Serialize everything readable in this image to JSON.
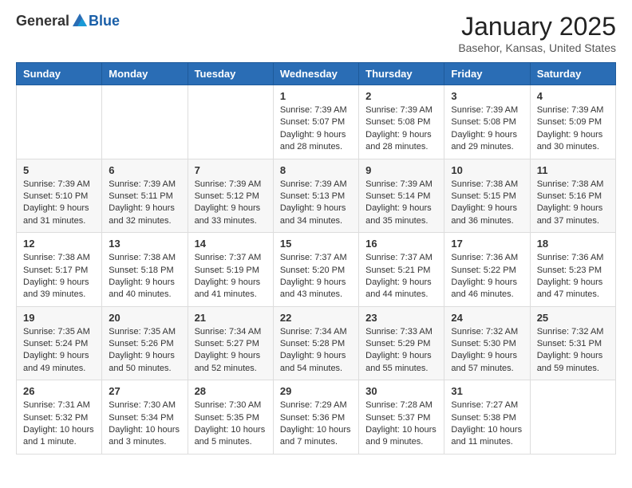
{
  "header": {
    "logo_general": "General",
    "logo_blue": "Blue",
    "title": "January 2025",
    "subtitle": "Basehor, Kansas, United States"
  },
  "weekdays": [
    "Sunday",
    "Monday",
    "Tuesday",
    "Wednesday",
    "Thursday",
    "Friday",
    "Saturday"
  ],
  "weeks": [
    [
      {
        "day": "",
        "info": ""
      },
      {
        "day": "",
        "info": ""
      },
      {
        "day": "",
        "info": ""
      },
      {
        "day": "1",
        "info": "Sunrise: 7:39 AM\nSunset: 5:07 PM\nDaylight: 9 hours\nand 28 minutes."
      },
      {
        "day": "2",
        "info": "Sunrise: 7:39 AM\nSunset: 5:08 PM\nDaylight: 9 hours\nand 28 minutes."
      },
      {
        "day": "3",
        "info": "Sunrise: 7:39 AM\nSunset: 5:08 PM\nDaylight: 9 hours\nand 29 minutes."
      },
      {
        "day": "4",
        "info": "Sunrise: 7:39 AM\nSunset: 5:09 PM\nDaylight: 9 hours\nand 30 minutes."
      }
    ],
    [
      {
        "day": "5",
        "info": "Sunrise: 7:39 AM\nSunset: 5:10 PM\nDaylight: 9 hours\nand 31 minutes."
      },
      {
        "day": "6",
        "info": "Sunrise: 7:39 AM\nSunset: 5:11 PM\nDaylight: 9 hours\nand 32 minutes."
      },
      {
        "day": "7",
        "info": "Sunrise: 7:39 AM\nSunset: 5:12 PM\nDaylight: 9 hours\nand 33 minutes."
      },
      {
        "day": "8",
        "info": "Sunrise: 7:39 AM\nSunset: 5:13 PM\nDaylight: 9 hours\nand 34 minutes."
      },
      {
        "day": "9",
        "info": "Sunrise: 7:39 AM\nSunset: 5:14 PM\nDaylight: 9 hours\nand 35 minutes."
      },
      {
        "day": "10",
        "info": "Sunrise: 7:38 AM\nSunset: 5:15 PM\nDaylight: 9 hours\nand 36 minutes."
      },
      {
        "day": "11",
        "info": "Sunrise: 7:38 AM\nSunset: 5:16 PM\nDaylight: 9 hours\nand 37 minutes."
      }
    ],
    [
      {
        "day": "12",
        "info": "Sunrise: 7:38 AM\nSunset: 5:17 PM\nDaylight: 9 hours\nand 39 minutes."
      },
      {
        "day": "13",
        "info": "Sunrise: 7:38 AM\nSunset: 5:18 PM\nDaylight: 9 hours\nand 40 minutes."
      },
      {
        "day": "14",
        "info": "Sunrise: 7:37 AM\nSunset: 5:19 PM\nDaylight: 9 hours\nand 41 minutes."
      },
      {
        "day": "15",
        "info": "Sunrise: 7:37 AM\nSunset: 5:20 PM\nDaylight: 9 hours\nand 43 minutes."
      },
      {
        "day": "16",
        "info": "Sunrise: 7:37 AM\nSunset: 5:21 PM\nDaylight: 9 hours\nand 44 minutes."
      },
      {
        "day": "17",
        "info": "Sunrise: 7:36 AM\nSunset: 5:22 PM\nDaylight: 9 hours\nand 46 minutes."
      },
      {
        "day": "18",
        "info": "Sunrise: 7:36 AM\nSunset: 5:23 PM\nDaylight: 9 hours\nand 47 minutes."
      }
    ],
    [
      {
        "day": "19",
        "info": "Sunrise: 7:35 AM\nSunset: 5:24 PM\nDaylight: 9 hours\nand 49 minutes."
      },
      {
        "day": "20",
        "info": "Sunrise: 7:35 AM\nSunset: 5:26 PM\nDaylight: 9 hours\nand 50 minutes."
      },
      {
        "day": "21",
        "info": "Sunrise: 7:34 AM\nSunset: 5:27 PM\nDaylight: 9 hours\nand 52 minutes."
      },
      {
        "day": "22",
        "info": "Sunrise: 7:34 AM\nSunset: 5:28 PM\nDaylight: 9 hours\nand 54 minutes."
      },
      {
        "day": "23",
        "info": "Sunrise: 7:33 AM\nSunset: 5:29 PM\nDaylight: 9 hours\nand 55 minutes."
      },
      {
        "day": "24",
        "info": "Sunrise: 7:32 AM\nSunset: 5:30 PM\nDaylight: 9 hours\nand 57 minutes."
      },
      {
        "day": "25",
        "info": "Sunrise: 7:32 AM\nSunset: 5:31 PM\nDaylight: 9 hours\nand 59 minutes."
      }
    ],
    [
      {
        "day": "26",
        "info": "Sunrise: 7:31 AM\nSunset: 5:32 PM\nDaylight: 10 hours\nand 1 minute."
      },
      {
        "day": "27",
        "info": "Sunrise: 7:30 AM\nSunset: 5:34 PM\nDaylight: 10 hours\nand 3 minutes."
      },
      {
        "day": "28",
        "info": "Sunrise: 7:30 AM\nSunset: 5:35 PM\nDaylight: 10 hours\nand 5 minutes."
      },
      {
        "day": "29",
        "info": "Sunrise: 7:29 AM\nSunset: 5:36 PM\nDaylight: 10 hours\nand 7 minutes."
      },
      {
        "day": "30",
        "info": "Sunrise: 7:28 AM\nSunset: 5:37 PM\nDaylight: 10 hours\nand 9 minutes."
      },
      {
        "day": "31",
        "info": "Sunrise: 7:27 AM\nSunset: 5:38 PM\nDaylight: 10 hours\nand 11 minutes."
      },
      {
        "day": "",
        "info": ""
      }
    ]
  ]
}
